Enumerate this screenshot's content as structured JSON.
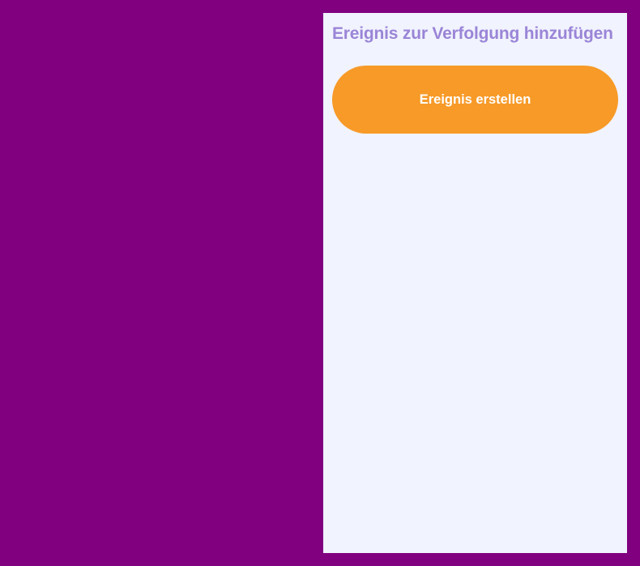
{
  "panel": {
    "title": "Ereignis zur Verfolgung hinzufügen",
    "create_button_label": "Ereignis erstellen"
  },
  "colors": {
    "background": "#800080",
    "panel": "#f1f3fe",
    "title": "#9a85d7",
    "button": "#f79a28"
  }
}
